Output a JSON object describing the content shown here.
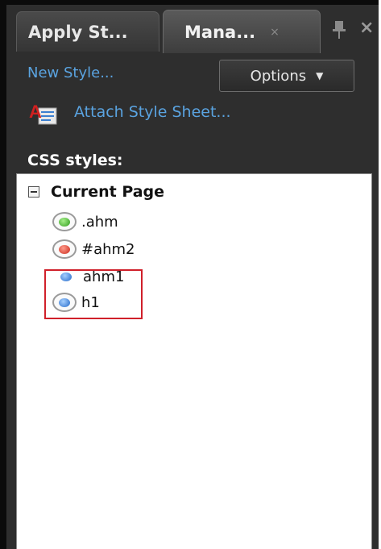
{
  "tabs": [
    {
      "label": "Apply St..."
    },
    {
      "label": "Mana...",
      "close_glyph": "×"
    }
  ],
  "panel_close_glyph": "×",
  "toolbar": {
    "new_style_label": "New Style...",
    "options_label": "Options",
    "attach_label": "Attach Style Sheet..."
  },
  "css_styles_label": "CSS styles:",
  "group": {
    "label": "Current Page"
  },
  "styles": [
    {
      "label": ".ahm",
      "kind": "class",
      "color": "#2f9a1c",
      "icon": "green-ring-bullet-icon"
    },
    {
      "label": "#ahm2",
      "kind": "id",
      "color": "#c8281a",
      "icon": "red-ring-bullet-icon"
    },
    {
      "label": "ahm1",
      "kind": "element",
      "color": "#2469c8",
      "icon": "blue-bullet-icon"
    },
    {
      "label": "h1",
      "kind": "element",
      "color": "#2469c8",
      "icon": "blue-ring-bullet-icon"
    }
  ],
  "colors": {
    "panel_bg": "#2e2e2e",
    "link": "#5aa3e0",
    "highlight": "#d0202a"
  }
}
